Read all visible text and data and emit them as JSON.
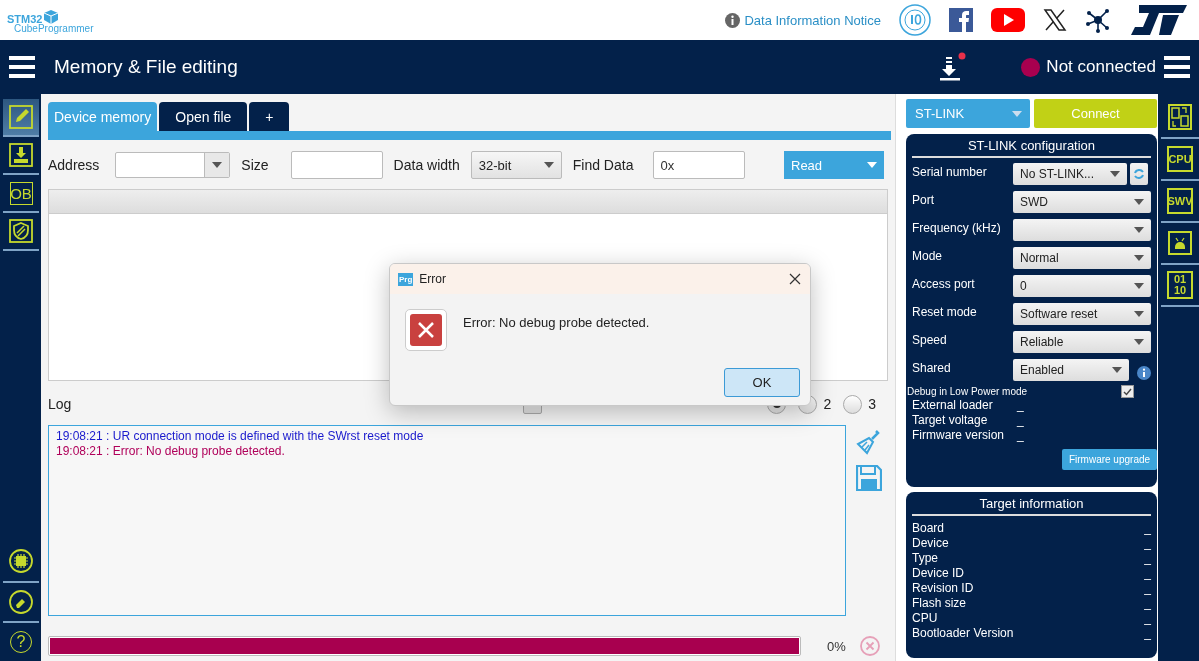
{
  "header": {
    "logo": {
      "line_1": "STM32",
      "line_2": "CubeProgrammer"
    },
    "notice_link": "Data Information Notice"
  },
  "navbar": {
    "title": "Memory & File editing",
    "status": "Not connected"
  },
  "left_sidebar": {
    "items": [
      {
        "kind": "edit",
        "selected": true
      },
      {
        "kind": "download",
        "selected": false
      },
      {
        "kind": "text",
        "label": "OB",
        "selected": false
      },
      {
        "kind": "shield",
        "selected": false
      }
    ],
    "bottom_items": [
      {
        "kind": "chip",
        "selected": false
      },
      {
        "kind": "eraser",
        "selected": false
      },
      {
        "kind": "help",
        "label": "?",
        "selected": false
      }
    ]
  },
  "tabs": [
    {
      "label": "Device memory",
      "selected": true
    },
    {
      "label": "Open file",
      "selected": false
    },
    {
      "label": "+",
      "selected": false
    }
  ],
  "memory_toolbar": {
    "address_label": "Address",
    "size_label": "Size",
    "data_width_label": "Data width",
    "data_width": "32-bit",
    "find_label": "Find Data",
    "find_value": "0x",
    "read_button": "Read"
  },
  "log": {
    "title": "Log",
    "live_update": {
      "checked": false
    },
    "verbosity": [
      {
        "selected": true
      },
      {
        "label": "2",
        "selected": false
      },
      {
        "label": "3",
        "selected": false
      }
    ],
    "lines": [
      {
        "kind": "info",
        "text": "19:08:21 : UR connection mode is defined with the SWrst reset mode"
      },
      {
        "kind": "error",
        "text": "19:08:21 : Error: No debug probe detected."
      }
    ]
  },
  "progress": {
    "level": 1,
    "reading": "0%"
  },
  "dialog": {
    "app_icon_label": "Prg",
    "title": "Error",
    "message": "Error: No debug probe detected.",
    "ok_button": "OK"
  },
  "connection": {
    "interface": "ST-LINK",
    "connect_button": "Connect",
    "config": {
      "title": "ST-LINK configuration",
      "fields": [
        {
          "kind": "refresh",
          "label": "Serial number",
          "value": "No ST-LINK..."
        },
        {
          "kind": "select",
          "label": "Port",
          "value": "SWD"
        },
        {
          "kind": "select",
          "label": "Frequency (kHz)"
        },
        {
          "kind": "select",
          "label": "Mode",
          "value": "Normal"
        },
        {
          "kind": "select",
          "label": "Access port",
          "value": "0"
        },
        {
          "kind": "select",
          "label": "Reset mode",
          "value": "Software reset"
        },
        {
          "kind": "select",
          "label": "Speed",
          "value": "Reliable"
        },
        {
          "kind": "info",
          "label": "Shared",
          "value": "Enabled"
        }
      ],
      "low_power": {
        "label": "Debug in Low Power mode",
        "checked": true
      },
      "info": [
        {
          "label": "External loader",
          "value": "_"
        },
        {
          "label": "Target voltage",
          "value": "_"
        },
        {
          "label": "Firmware version",
          "value": "_"
        }
      ],
      "firmware_button": "Firmware upgrade"
    },
    "target": {
      "title": "Target information",
      "rows": [
        {
          "label": "Board",
          "value": "_"
        },
        {
          "label": "Device",
          "value": "_"
        },
        {
          "label": "Type",
          "value": "_"
        },
        {
          "label": "Device ID",
          "value": "_"
        },
        {
          "label": "Revision ID",
          "value": "_"
        },
        {
          "label": "Flash size",
          "value": "_"
        },
        {
          "label": "CPU",
          "value": "_"
        },
        {
          "label": "Bootloader Version",
          "value": "_"
        }
      ]
    }
  },
  "right_toolbar": [
    {
      "kind": "pages"
    },
    {
      "kind": "text",
      "label": "CPU"
    },
    {
      "kind": "text",
      "label": "SWV"
    },
    {
      "kind": "bug"
    },
    {
      "kind": "text",
      "label": "01 10"
    }
  ]
}
